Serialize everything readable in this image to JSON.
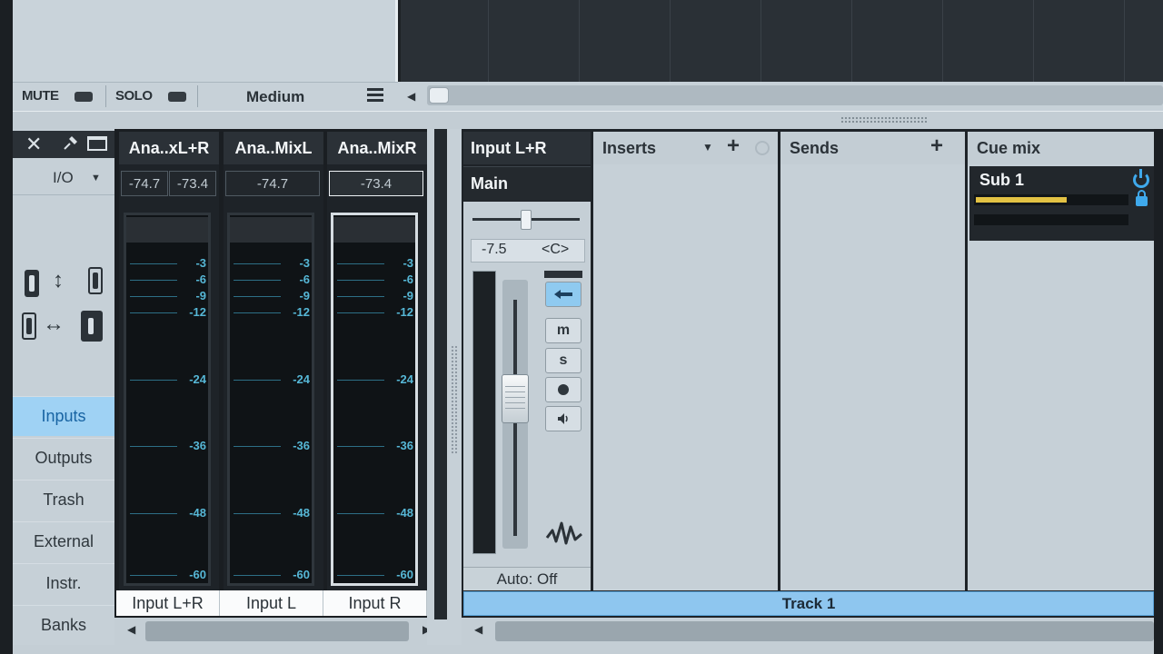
{
  "control_bar": {
    "mute_label": "MUTE",
    "solo_label": "SOLO",
    "size_label": "Medium"
  },
  "sidebar": {
    "io_label": "I/O",
    "items": [
      {
        "label": "Inputs",
        "active": true
      },
      {
        "label": "Outputs",
        "active": false
      },
      {
        "label": "Trash",
        "active": false
      },
      {
        "label": "External",
        "active": false
      },
      {
        "label": "Instr.",
        "active": false
      },
      {
        "label": "Banks",
        "active": false
      }
    ]
  },
  "channels": [
    {
      "header": "Ana..xL+R",
      "levels": [
        "-74.7",
        "-73.4"
      ],
      "name": "Input L+R",
      "selected": false
    },
    {
      "header": "Ana..MixL",
      "levels": [
        "-74.7"
      ],
      "name": "Input L",
      "selected": false
    },
    {
      "header": "Ana..MixR",
      "levels": [
        "-73.4"
      ],
      "name": "Input R",
      "selected": true
    }
  ],
  "meter_scale": [
    "-3",
    "-6",
    "-9",
    "-12",
    "-24",
    "-36",
    "-48",
    "-60"
  ],
  "main_strip": {
    "header": "Input L+R",
    "output": "Main",
    "volume": "-7.5",
    "pan": "<C>",
    "automation": "Auto: Off",
    "buttons": {
      "mute": "m",
      "solo": "s"
    }
  },
  "sections": {
    "inserts": "Inserts",
    "sends": "Sends",
    "cue_mix": "Cue mix",
    "cue_sub": "Sub 1",
    "cue_level": 0.6
  },
  "track": {
    "name": "Track 1"
  },
  "colors": {
    "accent": "#8ec6ef",
    "active_tab": "#9fd2f4",
    "meter_tick": "#56b7d6",
    "cue_level": "#e3c244"
  }
}
